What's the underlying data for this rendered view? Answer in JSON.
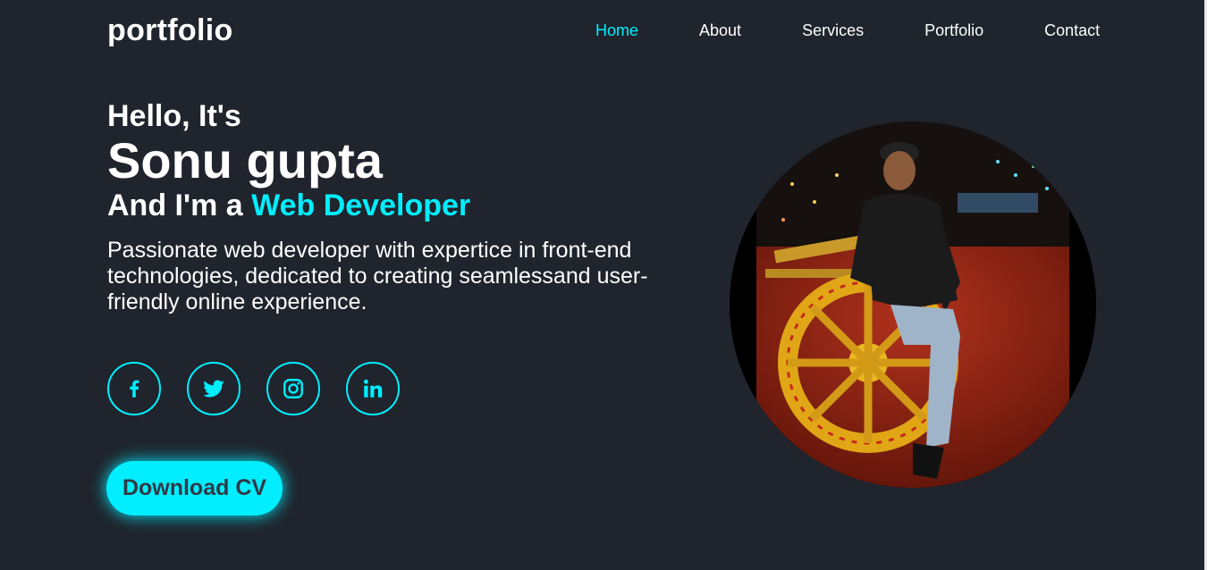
{
  "logo": "portfolio",
  "nav": {
    "items": [
      "Home",
      "About",
      "Services",
      "Portfolio",
      "Contact"
    ],
    "active": "Home"
  },
  "hero": {
    "hello": "Hello, It's",
    "name": "Sonu gupta",
    "role_prefix": "And I'm a ",
    "role_highlight": "Web Developer",
    "description": "Passionate web developer with expertice in front-end technologies, dedicated to creating seamlessand user-friendly online experience."
  },
  "socials": [
    "facebook-icon",
    "twitter-icon",
    "instagram-icon",
    "linkedin-icon"
  ],
  "cv_button": "Download CV",
  "colors": {
    "background": "#1f242d",
    "accent": "#00eeff",
    "text": "#ffffff",
    "button_text": "#323946"
  }
}
